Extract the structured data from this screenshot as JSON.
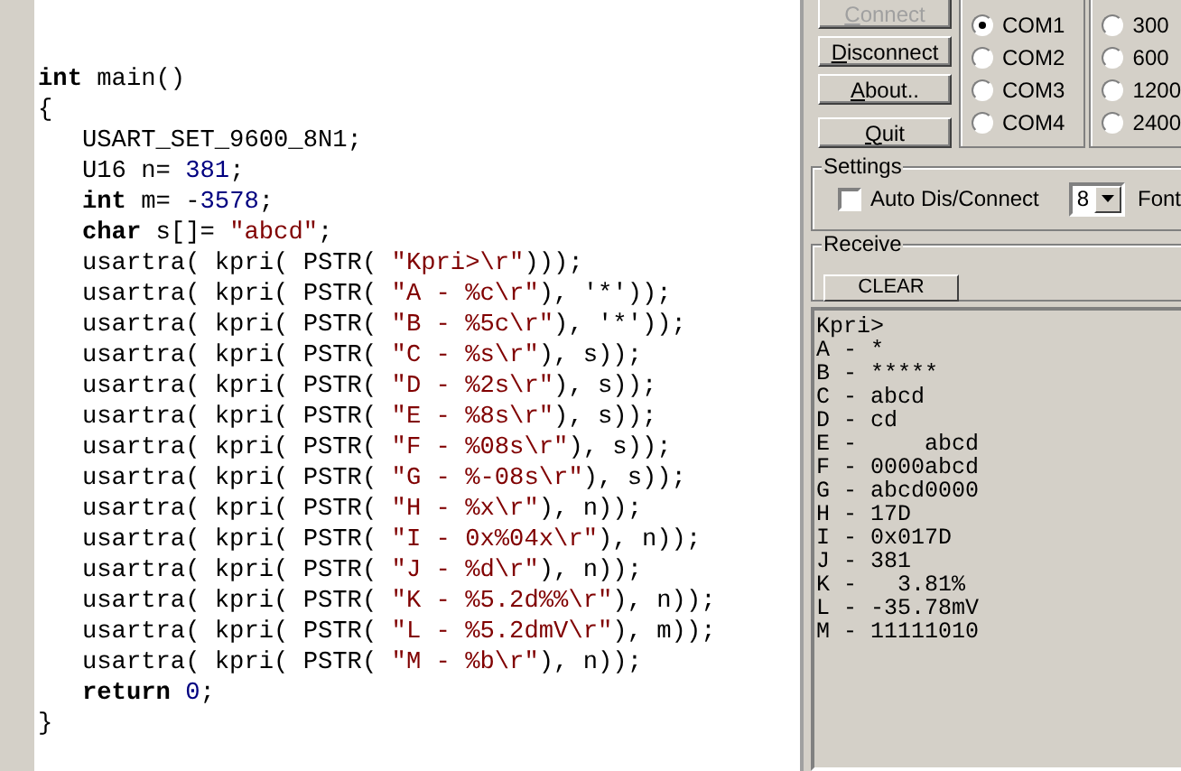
{
  "editor": {
    "lines": [
      [
        {
          "kind": "keyword",
          "text": "int"
        },
        {
          "kind": "plain",
          "text": " main()"
        }
      ],
      [
        {
          "kind": "plain",
          "text": "{"
        }
      ],
      [
        {
          "kind": "plain",
          "text": "   USART_SET_9600_8N1;"
        }
      ],
      [
        {
          "kind": "plain",
          "text": "   U16 n= "
        },
        {
          "kind": "number",
          "text": "381"
        },
        {
          "kind": "plain",
          "text": ";"
        }
      ],
      [
        {
          "kind": "keyword",
          "text": "   int"
        },
        {
          "kind": "plain",
          "text": " m= -"
        },
        {
          "kind": "number",
          "text": "3578"
        },
        {
          "kind": "plain",
          "text": ";"
        }
      ],
      [
        {
          "kind": "keyword",
          "text": "   char"
        },
        {
          "kind": "plain",
          "text": " s[]= "
        },
        {
          "kind": "string",
          "text": "\"abcd\""
        },
        {
          "kind": "plain",
          "text": ";"
        }
      ],
      [
        {
          "kind": "plain",
          "text": "   usartra( kpri( PSTR( "
        },
        {
          "kind": "string",
          "text": "\"Kpri>\\r\""
        },
        {
          "kind": "plain",
          "text": ")));"
        }
      ],
      [
        {
          "kind": "plain",
          "text": "   usartra( kpri( PSTR( "
        },
        {
          "kind": "string",
          "text": "\"A - %c\\r\""
        },
        {
          "kind": "plain",
          "text": "), '*'));"
        }
      ],
      [
        {
          "kind": "plain",
          "text": "   usartra( kpri( PSTR( "
        },
        {
          "kind": "string",
          "text": "\"B - %5c\\r\""
        },
        {
          "kind": "plain",
          "text": "), '*'));"
        }
      ],
      [
        {
          "kind": "plain",
          "text": "   usartra( kpri( PSTR( "
        },
        {
          "kind": "string",
          "text": "\"C - %s\\r\""
        },
        {
          "kind": "plain",
          "text": "), s));"
        }
      ],
      [
        {
          "kind": "plain",
          "text": "   usartra( kpri( PSTR( "
        },
        {
          "kind": "string",
          "text": "\"D - %2s\\r\""
        },
        {
          "kind": "plain",
          "text": "), s));"
        }
      ],
      [
        {
          "kind": "plain",
          "text": "   usartra( kpri( PSTR( "
        },
        {
          "kind": "string",
          "text": "\"E - %8s\\r\""
        },
        {
          "kind": "plain",
          "text": "), s));"
        }
      ],
      [
        {
          "kind": "plain",
          "text": "   usartra( kpri( PSTR( "
        },
        {
          "kind": "string",
          "text": "\"F - %08s\\r\""
        },
        {
          "kind": "plain",
          "text": "), s));"
        }
      ],
      [
        {
          "kind": "plain",
          "text": "   usartra( kpri( PSTR( "
        },
        {
          "kind": "string",
          "text": "\"G - %-08s\\r\""
        },
        {
          "kind": "plain",
          "text": "), s));"
        }
      ],
      [
        {
          "kind": "plain",
          "text": "   usartra( kpri( PSTR( "
        },
        {
          "kind": "string",
          "text": "\"H - %x\\r\""
        },
        {
          "kind": "plain",
          "text": "), n));"
        }
      ],
      [
        {
          "kind": "plain",
          "text": "   usartra( kpri( PSTR( "
        },
        {
          "kind": "string",
          "text": "\"I - 0x%04x\\r\""
        },
        {
          "kind": "plain",
          "text": "), n));"
        }
      ],
      [
        {
          "kind": "plain",
          "text": "   usartra( kpri( PSTR( "
        },
        {
          "kind": "string",
          "text": "\"J - %d\\r\""
        },
        {
          "kind": "plain",
          "text": "), n));"
        }
      ],
      [
        {
          "kind": "plain",
          "text": "   usartra( kpri( PSTR( "
        },
        {
          "kind": "string",
          "text": "\"K - %5.2d%%\\r\""
        },
        {
          "kind": "plain",
          "text": "), n));"
        }
      ],
      [
        {
          "kind": "plain",
          "text": "   usartra( kpri( PSTR( "
        },
        {
          "kind": "string",
          "text": "\"L - %5.2dmV\\r\""
        },
        {
          "kind": "plain",
          "text": "), m));"
        }
      ],
      [
        {
          "kind": "plain",
          "text": "   usartra( kpri( PSTR( "
        },
        {
          "kind": "string",
          "text": "\"M - %b\\r\""
        },
        {
          "kind": "plain",
          "text": "), n));"
        }
      ],
      [
        {
          "kind": "keyword",
          "text": "   return"
        },
        {
          "kind": "number",
          "text": " 0"
        },
        {
          "kind": "plain",
          "text": ";"
        }
      ],
      [
        {
          "kind": "plain",
          "text": "}"
        }
      ]
    ]
  },
  "buttons": [
    {
      "label": "Connect",
      "disabled": true
    },
    {
      "label": "Disconnect",
      "disabled": false
    },
    {
      "label": "About..",
      "disabled": false
    },
    {
      "label": "Quit",
      "disabled": false
    }
  ],
  "ports": [
    {
      "label": "COM1",
      "selected": true
    },
    {
      "label": "COM2",
      "selected": false
    },
    {
      "label": "COM3",
      "selected": false
    },
    {
      "label": "COM4",
      "selected": false
    }
  ],
  "bauds": [
    {
      "label": "300",
      "selected": false
    },
    {
      "label": "600",
      "selected": false
    },
    {
      "label": "1200",
      "selected": false
    },
    {
      "label": "2400",
      "selected": false
    }
  ],
  "settings": {
    "title": "Settings",
    "auto_connect": {
      "label": "Auto Dis/Connect",
      "checked": false
    },
    "font_size": "8",
    "font_label": "Font"
  },
  "receive": {
    "title": "Receive",
    "clear_button": "CLEAR",
    "lines": [
      "Kpri>",
      "A - *",
      "B - *****",
      "C - abcd",
      "D - cd",
      "E -     abcd",
      "F - 0000abcd",
      "G - abcd0000",
      "H - 17D",
      "I - 0x017D",
      "J - 381",
      "K -   3.81%",
      "L - -35.78mV",
      "M - 11111010"
    ]
  }
}
